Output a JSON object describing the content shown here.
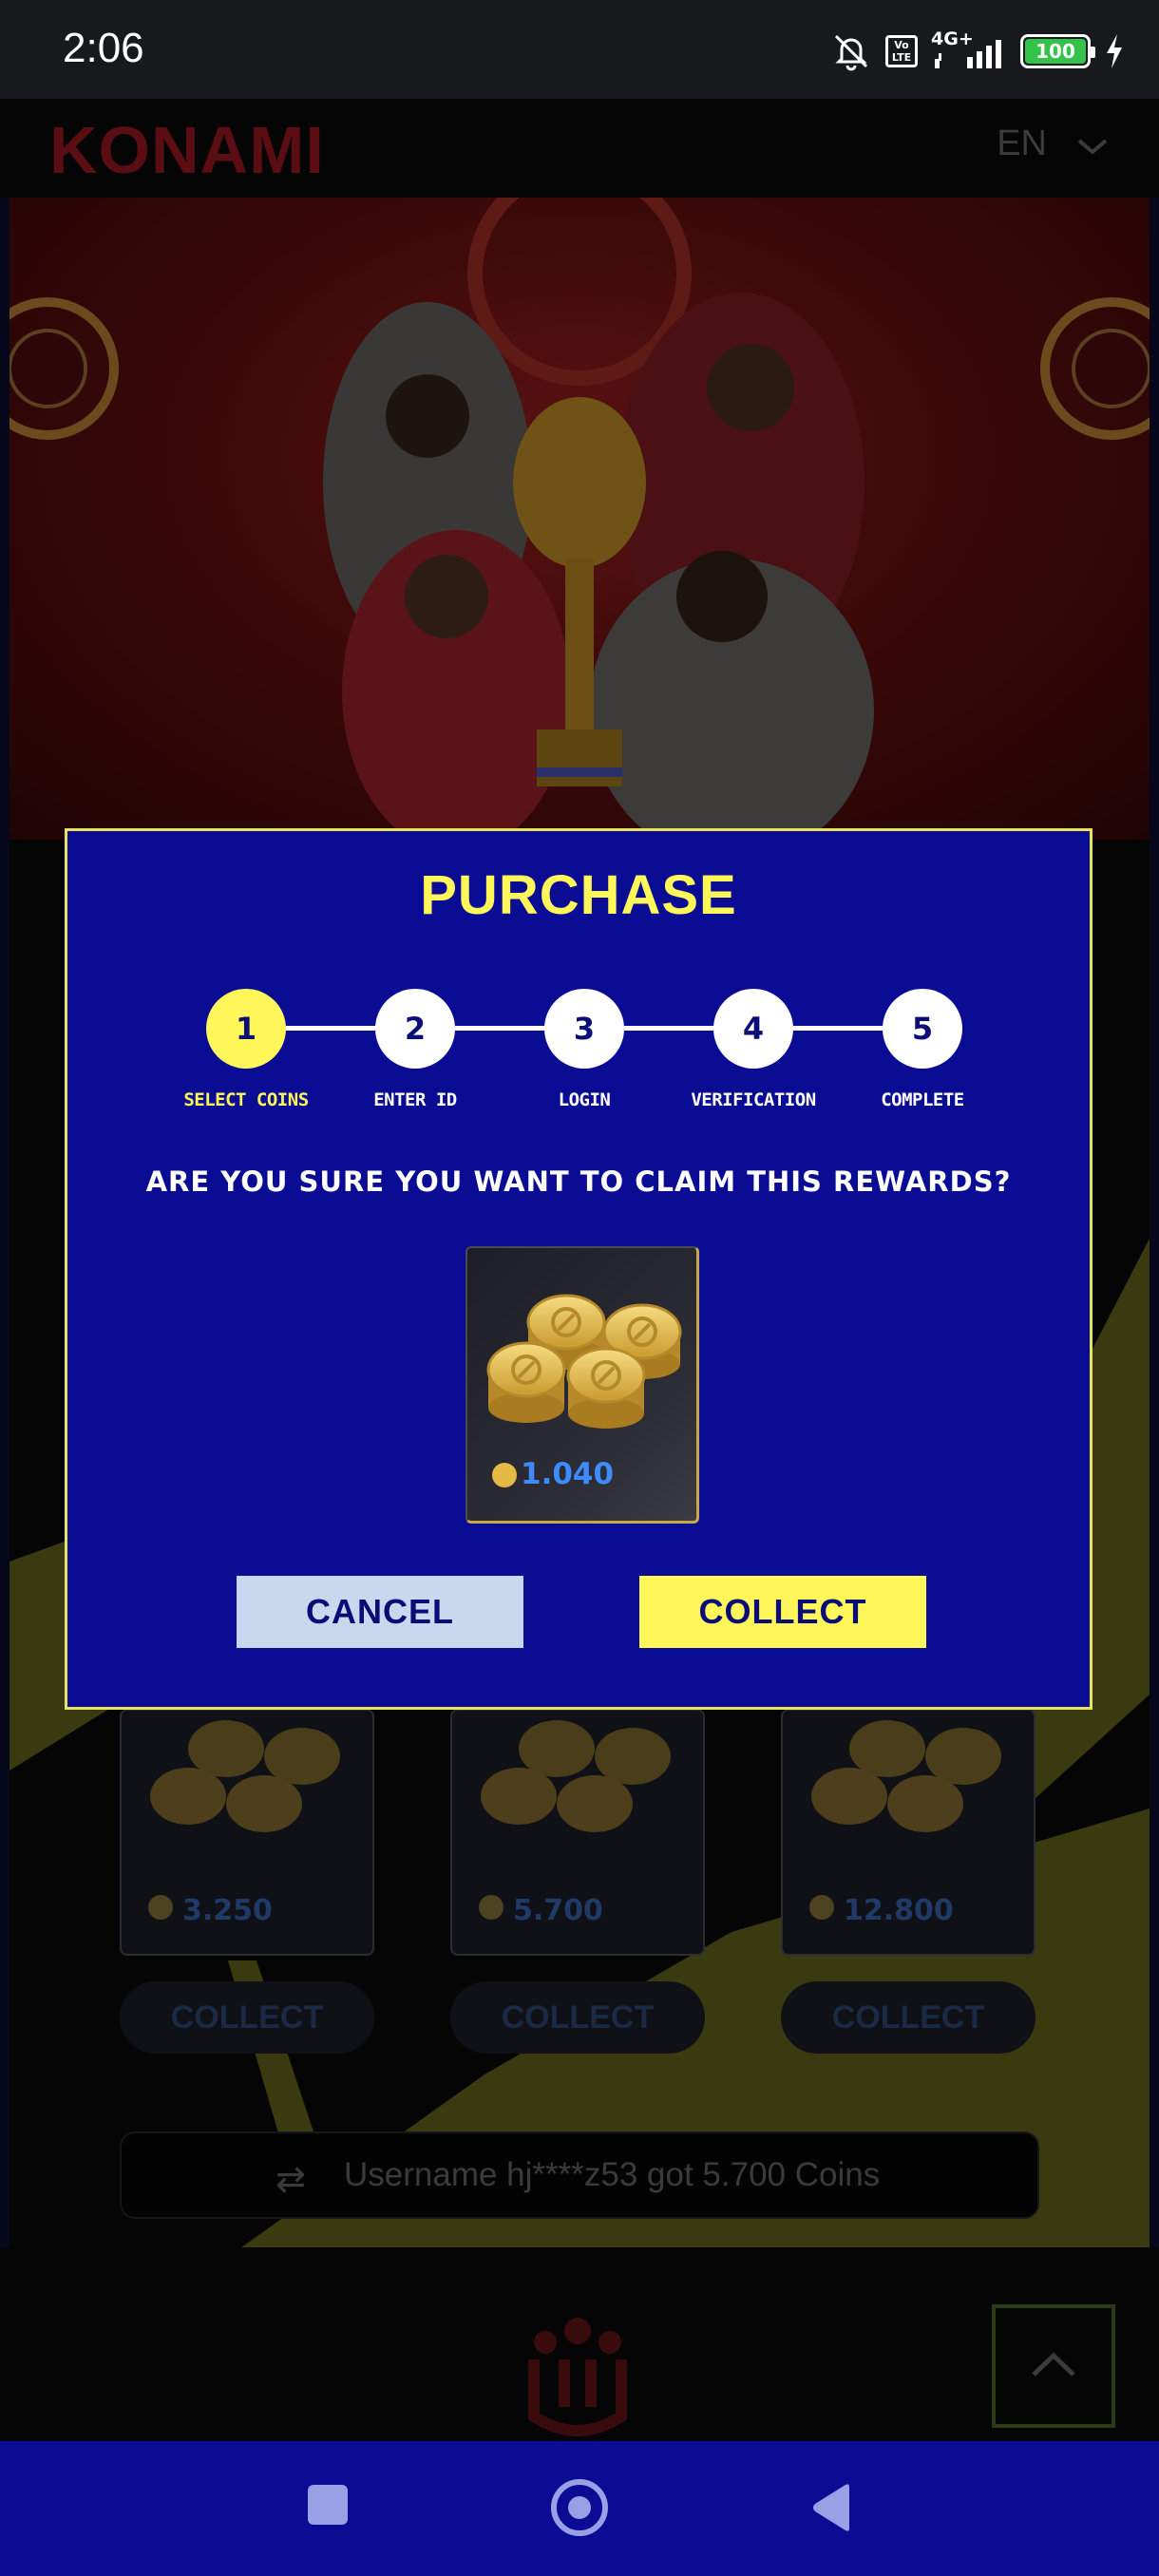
{
  "status_bar": {
    "time": "2:06",
    "network": "4G+",
    "volte": "Vo LTE",
    "battery": "100"
  },
  "header": {
    "logo": "KONAMI",
    "language": "EN"
  },
  "modal": {
    "title": "PURCHASE",
    "steps": [
      {
        "number": "1",
        "label": "SELECT COINS",
        "active": true
      },
      {
        "number": "2",
        "label": "ENTER ID",
        "active": false
      },
      {
        "number": "3",
        "label": "LOGIN",
        "active": false
      },
      {
        "number": "4",
        "label": "VERIFICATION",
        "active": false
      },
      {
        "number": "5",
        "label": "COMPLETE",
        "active": false
      }
    ],
    "question": "ARE YOU SURE YOU WANT TO CLAIM THIS REWARDS?",
    "reward_amount": "1.040",
    "cancel_label": "CANCEL",
    "collect_label": "COLLECT"
  },
  "background": {
    "packages": [
      {
        "amount": "3.250",
        "button": "COLLECT"
      },
      {
        "amount": "5.700",
        "button": "COLLECT"
      },
      {
        "amount": "12.800",
        "button": "COLLECT"
      }
    ],
    "ticker": "Username hj****z53 got 5.700 Coins"
  },
  "colors": {
    "modal_bg": "#0a0c94",
    "accent_yellow": "#fff75a",
    "cancel_bg": "#c9d8ee",
    "amount_blue": "#3e8bff"
  }
}
